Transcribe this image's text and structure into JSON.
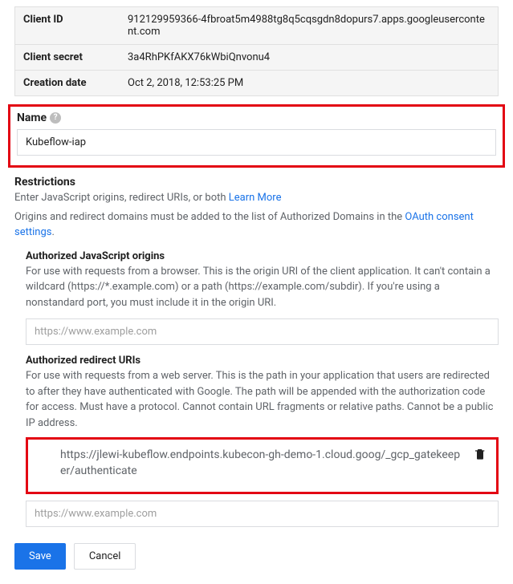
{
  "info": {
    "client_id_label": "Client ID",
    "client_id_value": "912129959366-4fbroat5m4988tg8q5cqsgdn8dopurs7.apps.googleusercontent.com",
    "client_secret_label": "Client secret",
    "client_secret_value": "3a4RhPKfAKX76kWbiQnvonu4",
    "creation_date_label": "Creation date",
    "creation_date_value": "Oct 2, 2018, 12:53:25 PM"
  },
  "name": {
    "label": "Name",
    "value": "Kubeflow-iap"
  },
  "restrictions": {
    "heading": "Restrictions",
    "desc_prefix": "Enter JavaScript origins, redirect URIs, or both ",
    "learn_more": "Learn More",
    "domains_prefix": "Origins and redirect domains must be added to the list of Authorized Domains in the ",
    "oauth_link": "OAuth consent settings",
    "domains_suffix": "."
  },
  "js_origins": {
    "heading": "Authorized JavaScript origins",
    "desc": "For use with requests from a browser. This is the origin URI of the client application. It can't contain a wildcard (https://*.example.com) or a path (https://example.com/subdir). If you're using a nonstandard port, you must include it in the origin URI.",
    "placeholder": "https://www.example.com"
  },
  "redirect_uris": {
    "heading": "Authorized redirect URIs",
    "desc": "For use with requests from a web server. This is the path in your application that users are redirected to after they have authenticated with Google. The path will be appended with the authorization code for access. Must have a protocol. Cannot contain URL fragments or relative paths. Cannot be a public IP address.",
    "uri": "https://jlewi-kubeflow.endpoints.kubecon-gh-demo-1.cloud.goog/_gcp_gatekeeper/authenticate",
    "placeholder": "https://www.example.com"
  },
  "buttons": {
    "save": "Save",
    "cancel": "Cancel"
  }
}
